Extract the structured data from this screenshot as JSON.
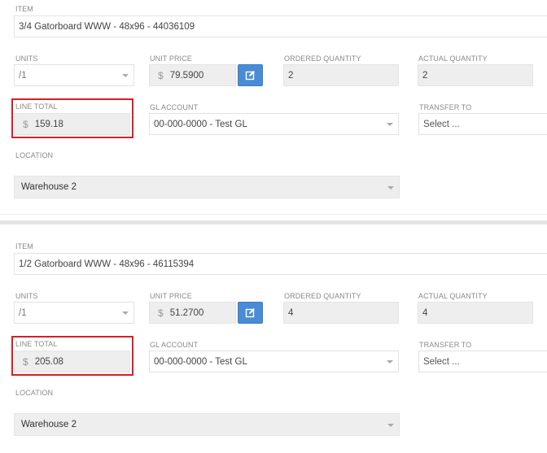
{
  "labels": {
    "item": "ITEM",
    "units": "UNITS",
    "unit_price": "UNIT PRICE",
    "ordered_quantity": "ORDERED QUANTITY",
    "actual_quantity": "ACTUAL QUANTITY",
    "line_total": "LINE TOTAL",
    "gl_account": "GL ACCOUNT",
    "transfer_to": "TRANSFER TO",
    "location": "LOCATION"
  },
  "currency_symbol": "$",
  "items": [
    {
      "item": "3/4 Gatorboard WWW - 48x96 - 44036109",
      "units": "/1",
      "unit_price": "79.5900",
      "ordered_quantity": "2",
      "actual_quantity": "2",
      "line_total": "159.18",
      "gl_account": "00-000-0000 - Test GL",
      "transfer_to_placeholder": "Select ...",
      "location": "Warehouse 2"
    },
    {
      "item": "1/2 Gatorboard WWW - 48x96 - 46115394",
      "units": "/1",
      "unit_price": "51.2700",
      "ordered_quantity": "4",
      "actual_quantity": "4",
      "line_total": "205.08",
      "gl_account": "00-000-0000 - Test GL",
      "transfer_to_placeholder": "Select ...",
      "location": "Warehouse 2"
    }
  ],
  "colors": {
    "highlight": "#d81f26",
    "edit_button": "#4a8bd6",
    "readonly_bg": "#eeeeee"
  }
}
